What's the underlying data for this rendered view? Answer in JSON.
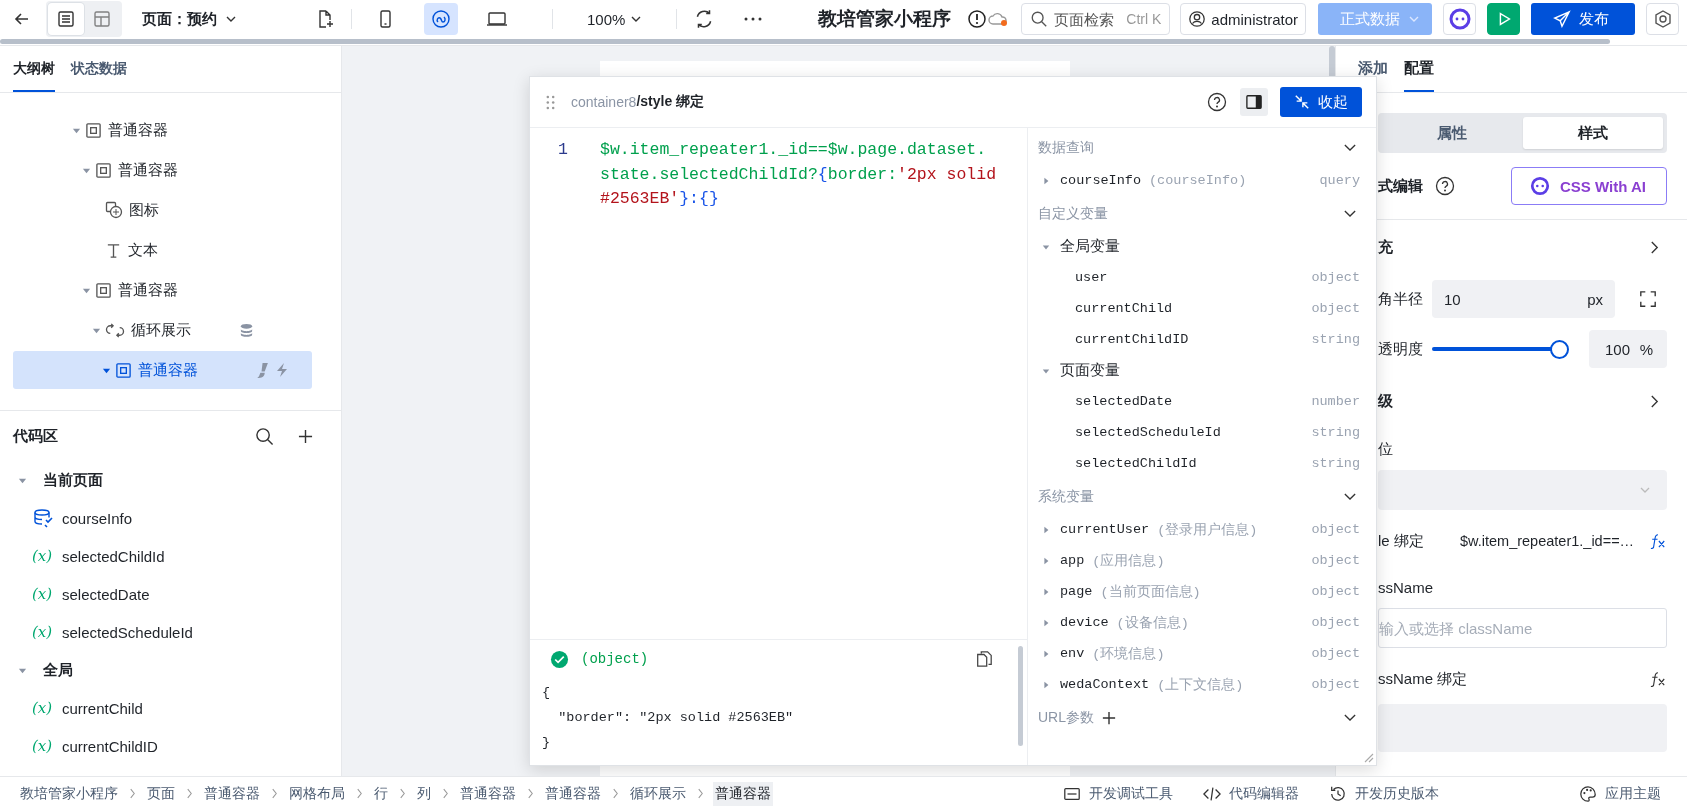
{
  "topbar": {
    "views": [
      {
        "kind": "outline",
        "selected": true
      },
      {
        "kind": "layout",
        "selected": false
      }
    ],
    "page_label": "页面：预约",
    "devices": [
      {
        "kind": "mobile",
        "selected": false
      },
      {
        "kind": "link",
        "selected": true
      },
      {
        "kind": "desktop",
        "selected": false
      }
    ],
    "zoom": "100%",
    "app_title": "教培管家小程序",
    "search": {
      "placeholder": "页面检索",
      "shortcut": "Ctrl K"
    },
    "user": "administrator",
    "env": "正式数据",
    "publish": "发布"
  },
  "left": {
    "tabs": [
      {
        "label": "大纲树",
        "selected": true
      },
      {
        "label": "状态数据",
        "selected": false
      }
    ],
    "tree": [
      {
        "label": "普通容器",
        "kind": "container",
        "expanded": true,
        "selected": false,
        "children": [
          {
            "label": "普通容器",
            "kind": "container",
            "expanded": true,
            "selected": false,
            "children": [
              {
                "label": "图标",
                "kind": "icon",
                "selected": false
              },
              {
                "label": "文本",
                "kind": "text",
                "selected": false
              }
            ]
          },
          {
            "label": "普通容器",
            "kind": "container",
            "expanded": true,
            "selected": false,
            "children": [
              {
                "label": "循环展示",
                "kind": "loop",
                "expanded": true,
                "selected": false,
                "has_data_source": true,
                "children": [
                  {
                    "label": "普通容器",
                    "kind": "container",
                    "expanded": true,
                    "selected": true,
                    "has_style_binding": true,
                    "has_events": true
                  }
                ]
              }
            ]
          }
        ]
      }
    ],
    "code_title": "代码区",
    "code_groups": [
      {
        "label": "当前页面",
        "expanded": true,
        "items": [
          {
            "kind": "query",
            "name": "courseInfo"
          },
          {
            "kind": "variable",
            "symbol": "(x)",
            "name": "selectedChildId"
          },
          {
            "kind": "variable",
            "symbol": "(x)",
            "name": "selectedDate"
          },
          {
            "kind": "variable",
            "symbol": "(x)",
            "name": "selectedScheduleId"
          }
        ]
      },
      {
        "label": "全局",
        "expanded": true,
        "items": [
          {
            "kind": "variable",
            "symbol": "(x)",
            "name": "currentChild"
          },
          {
            "kind": "variable",
            "symbol": "(x)",
            "name": "currentChildID"
          }
        ]
      }
    ]
  },
  "modal": {
    "path": "container8",
    "title": "/style 绑定",
    "collapse": "收起",
    "code_lines": [
      {
        "number": "1",
        "tokens": [
          {
            "kind": "expr",
            "text": "$w.item_repeater1._id==$w.page.dataset."
          },
          {
            "kind": "expr",
            "text": "state.selectedChildId?"
          },
          {
            "kind": "punct",
            "text": "{"
          },
          {
            "kind": "expr",
            "text": "border:"
          },
          {
            "kind": "string",
            "text": "'2px solid #2563EB'"
          },
          {
            "kind": "punct",
            "text": "}:{}"
          }
        ]
      }
    ],
    "result": {
      "type": "(object)",
      "valid": true,
      "lines": [
        "{",
        "  \"border\": \"2px solid #2563EB\"",
        "}"
      ]
    },
    "sections": [
      {
        "title": "数据查询",
        "expanded": true,
        "rows": [
          {
            "kind": "entry",
            "name": "courseInfo",
            "note": "(courseInfo)",
            "type": "query",
            "expanded": false
          }
        ]
      },
      {
        "title": "自定义变量",
        "expanded": true,
        "rows": [
          {
            "kind": "group",
            "label": "全局变量",
            "expanded": true,
            "children": [
              {
                "name": "user",
                "type": "object"
              },
              {
                "name": "currentChild",
                "type": "object"
              },
              {
                "name": "currentChildID",
                "type": "string"
              }
            ]
          },
          {
            "kind": "group",
            "label": "页面变量",
            "expanded": true,
            "children": [
              {
                "name": "selectedDate",
                "type": "number"
              },
              {
                "name": "selectedScheduleId",
                "type": "string"
              },
              {
                "name": "selectedChildId",
                "type": "string"
              }
            ]
          }
        ]
      },
      {
        "title": "系统变量",
        "expanded": true,
        "rows": [
          {
            "kind": "entry",
            "name": "currentUser",
            "note": "(登录用户信息)",
            "type": "object",
            "expanded": false
          },
          {
            "kind": "entry",
            "name": "app",
            "note": "(应用信息)",
            "type": "object",
            "expanded": false
          },
          {
            "kind": "entry",
            "name": "page",
            "note": "(当前页面信息)",
            "type": "object",
            "expanded": false
          },
          {
            "kind": "entry",
            "name": "device",
            "note": "(设备信息)",
            "type": "object",
            "expanded": false
          },
          {
            "kind": "entry",
            "name": "env",
            "note": "(环境信息)",
            "type": "object",
            "expanded": false
          },
          {
            "kind": "entry",
            "name": "wedaContext",
            "note": "(上下文信息)",
            "type": "object",
            "expanded": false
          }
        ]
      },
      {
        "title": "URL参数",
        "expanded": true,
        "addable": true
      }
    ]
  },
  "right_panel": {
    "tabs": [
      {
        "label": "添加",
        "selected": false
      },
      {
        "label": "配置",
        "selected": true
      }
    ],
    "segments": [
      {
        "label": "属性",
        "selected": false
      },
      {
        "label": "样式",
        "selected": true
      }
    ],
    "style_editor": {
      "label": "式编辑",
      "ai_button": "CSS With AI"
    },
    "fill_section": "充",
    "radius": {
      "label": "角半径",
      "value": "10",
      "unit": "px"
    },
    "opacity": {
      "label": "透明度",
      "level": 1,
      "value": "100",
      "unit": "%"
    },
    "level_section": "级",
    "position": {
      "label": "位"
    },
    "style_binding": {
      "label": "le 绑定",
      "value": "$w.item_repeater1._id==…"
    },
    "class_name": {
      "label": "ssName",
      "placeholder": "输入或选择 className"
    },
    "class_binding": {
      "label": "ssName 绑定"
    }
  },
  "bottom": {
    "breadcrumbs": [
      {
        "label": "教培管家小程序",
        "selected": false
      },
      {
        "label": "页面",
        "selected": false
      },
      {
        "label": "普通容器",
        "selected": false
      },
      {
        "label": "网格布局",
        "selected": false
      },
      {
        "label": "行",
        "selected": false
      },
      {
        "label": "列",
        "selected": false
      },
      {
        "label": "普通容器",
        "selected": false
      },
      {
        "label": "普通容器",
        "selected": false
      },
      {
        "label": "循环展示",
        "selected": false
      },
      {
        "label": "普通容器",
        "selected": true
      }
    ],
    "tools": [
      {
        "kind": "debug",
        "label": "开发调试工具"
      },
      {
        "kind": "code",
        "label": "代码编辑器"
      },
      {
        "kind": "history",
        "label": "开发历史版本"
      },
      {
        "kind": "theme",
        "label": "应用主题"
      }
    ]
  }
}
